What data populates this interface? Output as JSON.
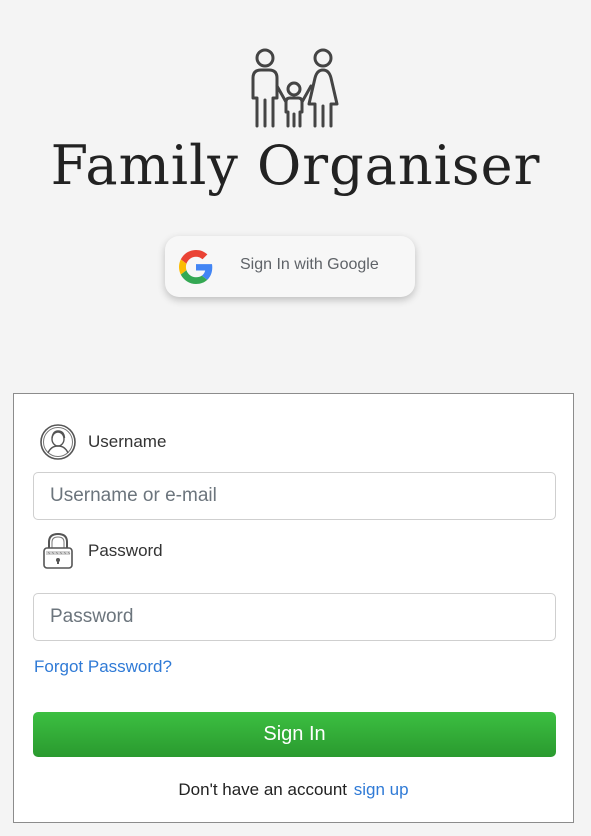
{
  "app": {
    "title": "Family Organiser",
    "logo_icon": "family-icon"
  },
  "google_signin": {
    "label": "Sign In with Google",
    "icon": "google-g-icon"
  },
  "login_form": {
    "username": {
      "label": "Username",
      "icon": "user-avatar-icon",
      "placeholder": "Username or e-mail",
      "value": ""
    },
    "password": {
      "label": "Password",
      "icon": "padlock-icon",
      "placeholder": "Password",
      "value": ""
    },
    "forgot_password_label": "Forgot Password?",
    "submit_label": "Sign In",
    "signup_prompt": "Don't have an account",
    "signup_link_label": "sign up"
  },
  "colors": {
    "background": "#f4f4f4",
    "primary_green": "#2fa835",
    "link_blue": "#2f7ad6",
    "title_text": "#222222"
  }
}
